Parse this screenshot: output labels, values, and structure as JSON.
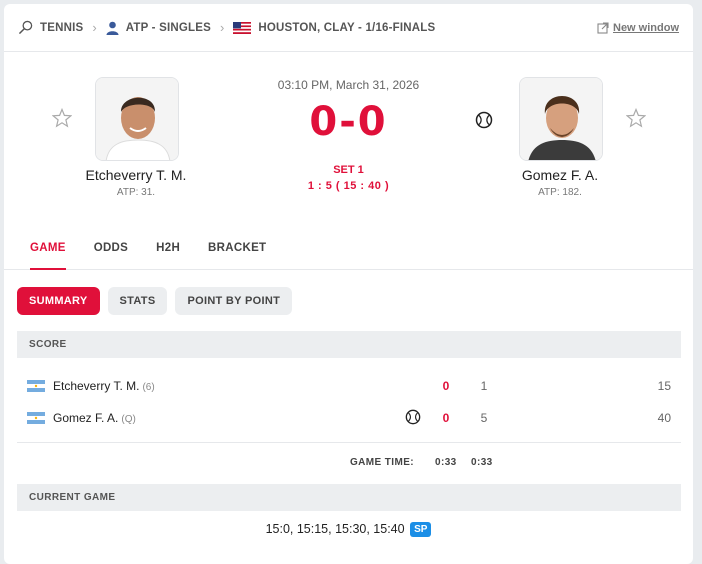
{
  "breadcrumb": {
    "sport": "TENNIS",
    "category": "ATP - SINGLES",
    "tournament": "HOUSTON, CLAY - 1/16-FINALS",
    "new_window": "New window"
  },
  "match": {
    "datetime": "03:10 PM, March 31, 2026",
    "score": "0-0",
    "set_label": "SET 1",
    "game_score": "1 : 5 ( 15 : 40 )",
    "home": {
      "name": "Etcheverry T. M.",
      "rank": "ATP: 31."
    },
    "away": {
      "name": "Gomez F. A.",
      "rank": "ATP: 182."
    }
  },
  "tabs": [
    "GAME",
    "ODDS",
    "H2H",
    "BRACKET"
  ],
  "subtabs": [
    "SUMMARY",
    "STATS",
    "POINT BY POINT"
  ],
  "score_section": {
    "title": "SCORE",
    "rows": [
      {
        "name": "Etcheverry T. M.",
        "seed": "(6)",
        "sets": "0",
        "games": "1",
        "points": "15"
      },
      {
        "name": "Gomez F. A.",
        "seed": "(Q)",
        "sets": "0",
        "games": "5",
        "points": "40"
      }
    ],
    "game_time_label": "GAME TIME:",
    "game_time_values": [
      "0:33",
      "0:33"
    ]
  },
  "current_game": {
    "title": "CURRENT GAME",
    "progression": "15:0, 15:15, 15:30, 15:40",
    "badge": "SP"
  },
  "colors": {
    "accent": "#e0103a",
    "badge_blue": "#1b8ee6"
  }
}
